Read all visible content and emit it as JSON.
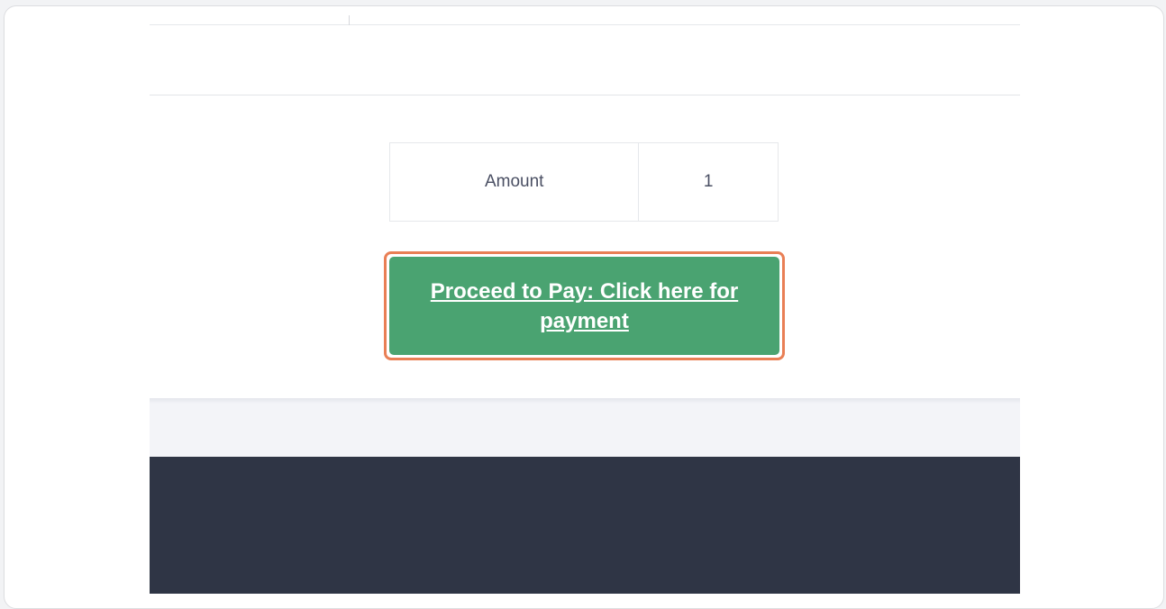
{
  "amount_table": {
    "label": "Amount",
    "value": "1"
  },
  "pay_button": {
    "label": "Proceed to Pay: Click here for payment"
  },
  "colors": {
    "button_green": "#4aa371",
    "highlight_orange": "#e97f55",
    "footer_dark": "#2f3545"
  }
}
